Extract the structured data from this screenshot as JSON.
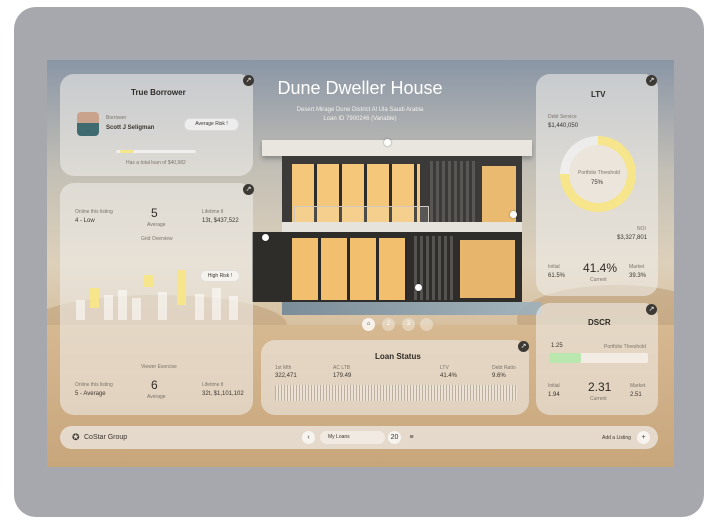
{
  "property": {
    "title": "Dune Dweller House",
    "address": "Desert Mirage Dune District Al Ula Saudi Arabia",
    "loan_id": "Loan ID 7900246 (Variable)"
  },
  "true_borrower": {
    "title": "True Borrower",
    "role_label": "Borrower",
    "name": "Scott J Seligman",
    "risk_badge": "Average Risk",
    "risk_badge_mark": "!",
    "total_loan_text": "Has a total loan of $40,982"
  },
  "risk_card": {
    "top_left_label": "Online this listing",
    "top_left_value": "4 - Low",
    "top_center_value": "5",
    "top_center_label": "Average",
    "top_right_label": "Lifetime tl",
    "top_right_value": "13t, $437,522",
    "mid_label": "Grid Overview",
    "high_risk_badge": "High Risk",
    "high_risk_mark": "!",
    "bottom_mid_label": "Viewer Exercise",
    "bottom_left_label": "Online this listing",
    "bottom_left_value": "5 - Average",
    "bottom_center_value": "6",
    "bottom_center_label": "Average",
    "bottom_right_label": "Lifetime tl",
    "bottom_right_value": "32t, $1,101,102"
  },
  "ltv": {
    "title": "LTV",
    "debt_label": "Debt Service",
    "debt_value": "$1,440,050",
    "threshold_label": "Portfolio Threshold",
    "threshold_value": "75%",
    "threshold_fraction": 0.75,
    "noi_label": "NOI",
    "noi_value": "$3,327,801",
    "initial_label": "Initial",
    "initial_value": "61.5%",
    "current_value": "41.4%",
    "current_label": "Current",
    "market_label": "Market",
    "market_value": "39.3%"
  },
  "dscr": {
    "title": "DSCR",
    "bar_value": "1.25",
    "bar_fraction": 0.32,
    "threshold_label": "Portfolio Threshold",
    "initial_label": "Initial",
    "initial_value": "1.94",
    "current_value": "2.31",
    "current_label": "Current",
    "market_label": "Market",
    "market_value": "2.51"
  },
  "loan_status": {
    "title": "Loan Status",
    "items": [
      {
        "label": "1st Mth",
        "value": "322,471"
      },
      {
        "label": "AC LTB",
        "value": "179.49"
      },
      {
        "label": "LTV",
        "value": "41.4%"
      },
      {
        "label": "Debt Ratio",
        "value": "9.6%"
      }
    ]
  },
  "pager": {
    "items": [
      "⌂",
      "2",
      "3"
    ]
  },
  "bottom_bar": {
    "logo_text": "CoStar Group",
    "logo_mark": "✪",
    "prev_icon": "‹",
    "tab_label": "My Loans",
    "next_icon": "›",
    "count": "20",
    "filter_icon": "≡",
    "add_label": "Add a Listing",
    "add_icon": "+"
  },
  "icons": {
    "expand": "↗",
    "accent_yellow": "#f6e58a",
    "accent_green": "#b9e7ae"
  }
}
